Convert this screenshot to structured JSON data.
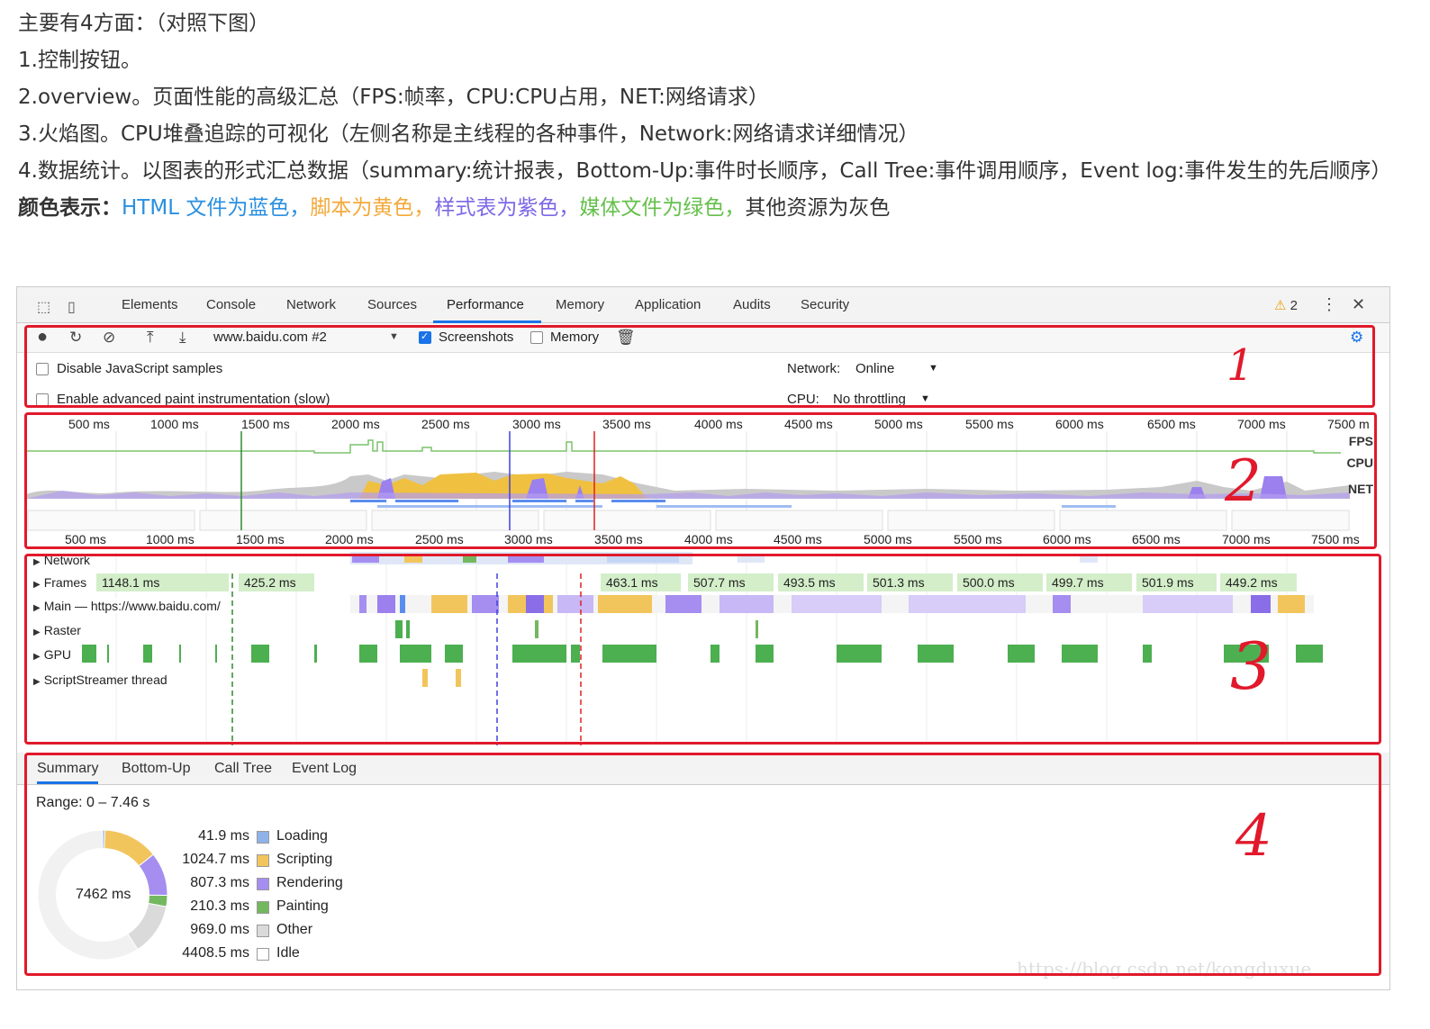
{
  "article": {
    "line1": "主要有4方面：（对照下图）",
    "line2": "1.控制按钮。",
    "line3": "2.overview。页面性能的高级汇总（FPS:帧率，CPU:CPU占用，NET:网络请求）",
    "line4": "3.火焰图。CPU堆叠追踪的可视化（左侧名称是主线程的各种事件，Network:网络请求详细情况）",
    "line5": "4.数据统计。以图表的形式汇总数据（summary:统计报表，Bottom-Up:事件时长顺序，Call Tree:事件调用顺序，Event log:事件发生的先后顺序）",
    "color_title": "颜色表示：",
    "color_html": "HTML 文件为蓝色，",
    "color_script": "脚本为黄色，",
    "color_style": "样式表为紫色，",
    "color_media": "媒体文件为绿色，",
    "color_other": "其他资源为灰色"
  },
  "devtools": {
    "tabs": [
      "Elements",
      "Console",
      "Network",
      "Sources",
      "Performance",
      "Memory",
      "Application",
      "Audits",
      "Security"
    ],
    "warning_count": "2",
    "url_select": "www.baidu.com #2",
    "screenshots_label": "Screenshots",
    "memory_label": "Memory",
    "disable_js": "Disable JavaScript samples",
    "enable_paint": "Enable advanced paint instrumentation (slow)",
    "network_label": "Network:",
    "network_value": "Online",
    "cpu_label": "CPU:",
    "cpu_value": "No throttling",
    "overview_ticks_top": [
      "500 ms",
      "1000 ms",
      "1500 ms",
      "2000 ms",
      "2500 ms",
      "3000 ms",
      "3500 ms",
      "4000 ms",
      "4500 ms",
      "5000 ms",
      "5500 ms",
      "6000 ms",
      "6500 ms",
      "7000 ms",
      "7500 m"
    ],
    "overview_ticks_bottom": [
      "500 ms",
      "1000 ms",
      "1500 ms",
      "2000 ms",
      "2500 ms",
      "3000 ms",
      "3500 ms",
      "4000 ms",
      "4500 ms",
      "5000 ms",
      "5500 ms",
      "6000 ms",
      "6500 ms",
      "7000 ms",
      "7500 ms"
    ],
    "fps_label": "FPS",
    "cpu_lane": "CPU",
    "net_lane": "NET",
    "tracks": {
      "network": "Network",
      "frames": "Frames",
      "main": "Main — https://www.baidu.com/",
      "raster": "Raster",
      "gpu": "GPU",
      "scriptstreamer": "ScriptStreamer thread"
    },
    "frames": [
      "1148.1 ms",
      "425.2 ms",
      "463.1 ms",
      "507.7 ms",
      "493.5 ms",
      "501.3 ms",
      "500.0 ms",
      "499.7 ms",
      "501.9 ms",
      "449.2 ms"
    ],
    "summary_tabs": [
      "Summary",
      "Bottom-Up",
      "Call Tree",
      "Event Log"
    ],
    "range": "Range: 0 – 7.46 s",
    "donut_total": "7462 ms",
    "legend": [
      {
        "ms": "41.9 ms",
        "name": "Loading",
        "color": "#8fb3e8"
      },
      {
        "ms": "1024.7 ms",
        "name": "Scripting",
        "color": "#f2c55c"
      },
      {
        "ms": "807.3 ms",
        "name": "Rendering",
        "color": "#a58ef0"
      },
      {
        "ms": "210.3 ms",
        "name": "Painting",
        "color": "#73b85f"
      },
      {
        "ms": "969.0 ms",
        "name": "Other",
        "color": "#dadada"
      },
      {
        "ms": "4408.5 ms",
        "name": "Idle",
        "color": "#ffffff"
      }
    ],
    "watermark": "https://blog.csdn.net/kongduxue"
  },
  "annotations": [
    "1",
    "2",
    "3",
    "4"
  ]
}
